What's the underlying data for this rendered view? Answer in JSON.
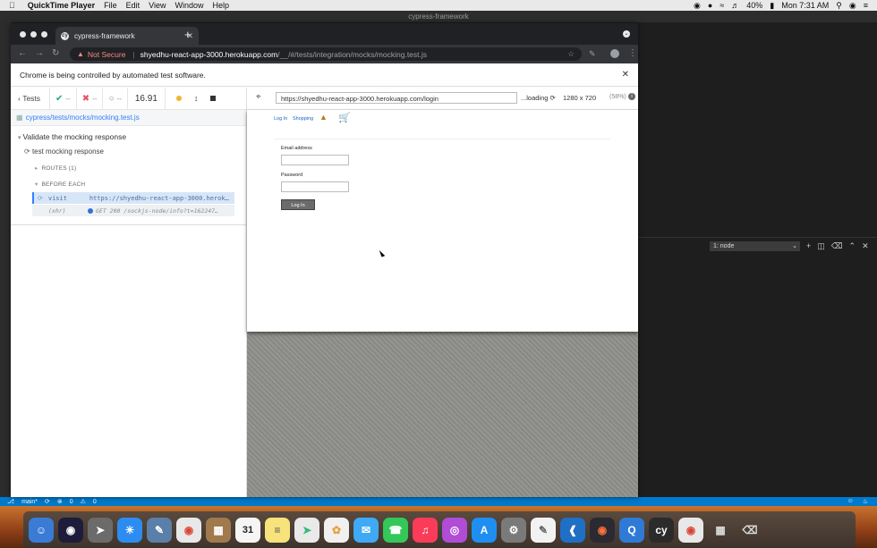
{
  "mac_menubar": {
    "app_name": "QuickTime Player",
    "menus": [
      "File",
      "Edit",
      "View",
      "Window",
      "Help"
    ],
    "battery": "40%",
    "clock": "Mon 7:31 AM"
  },
  "vscode": {
    "title": "cypress-framework",
    "terminal_select": "1: node",
    "status_branch": "main*",
    "status_errors": "0",
    "status_warnings": "0"
  },
  "chrome": {
    "tab_title": "cypress-framework",
    "url_security": "Not Secure",
    "url_host": "shyedhu-react-app-3000.herokuapp.com",
    "url_path": "/__/#/tests/integration/mocks/mocking.test.js",
    "infobar_text": "Chrome is being controlled by automated test software."
  },
  "reporter": {
    "tests_label": "Tests",
    "passed": "--",
    "failed": "--",
    "pending": "--",
    "duration": "16.91",
    "spec_file": "cypress/tests/mocks/mocking.test.js",
    "suite_title": "Validate the mocking response",
    "test_title": "test mocking response",
    "routes_label": "ROUTES (1)",
    "before_each_label": "BEFORE EACH",
    "cmd_visit_name": "visit",
    "cmd_visit_msg": "https://shyedhu-react-app-3000.herok…",
    "cmd_xhr_name": "(xhr)",
    "cmd_xhr_msg": "GET 200 /sockjs-node/info?t=162247…"
  },
  "aut": {
    "url": "https://shyedhu-react-app-3000.herokuapp.com/login",
    "loading": "...loading",
    "viewport": "1280 x 720",
    "scale": "(58%)",
    "nav_login": "Log In",
    "nav_shopping": "Shopping",
    "email_label": "Email address",
    "password_label": "Password",
    "login_button": "Log In"
  },
  "colors": {
    "cypress_blue": "#3380ff",
    "vscode_status": "#007acc",
    "pass_green": "#1fa971",
    "fail_red": "#e94f5f"
  }
}
